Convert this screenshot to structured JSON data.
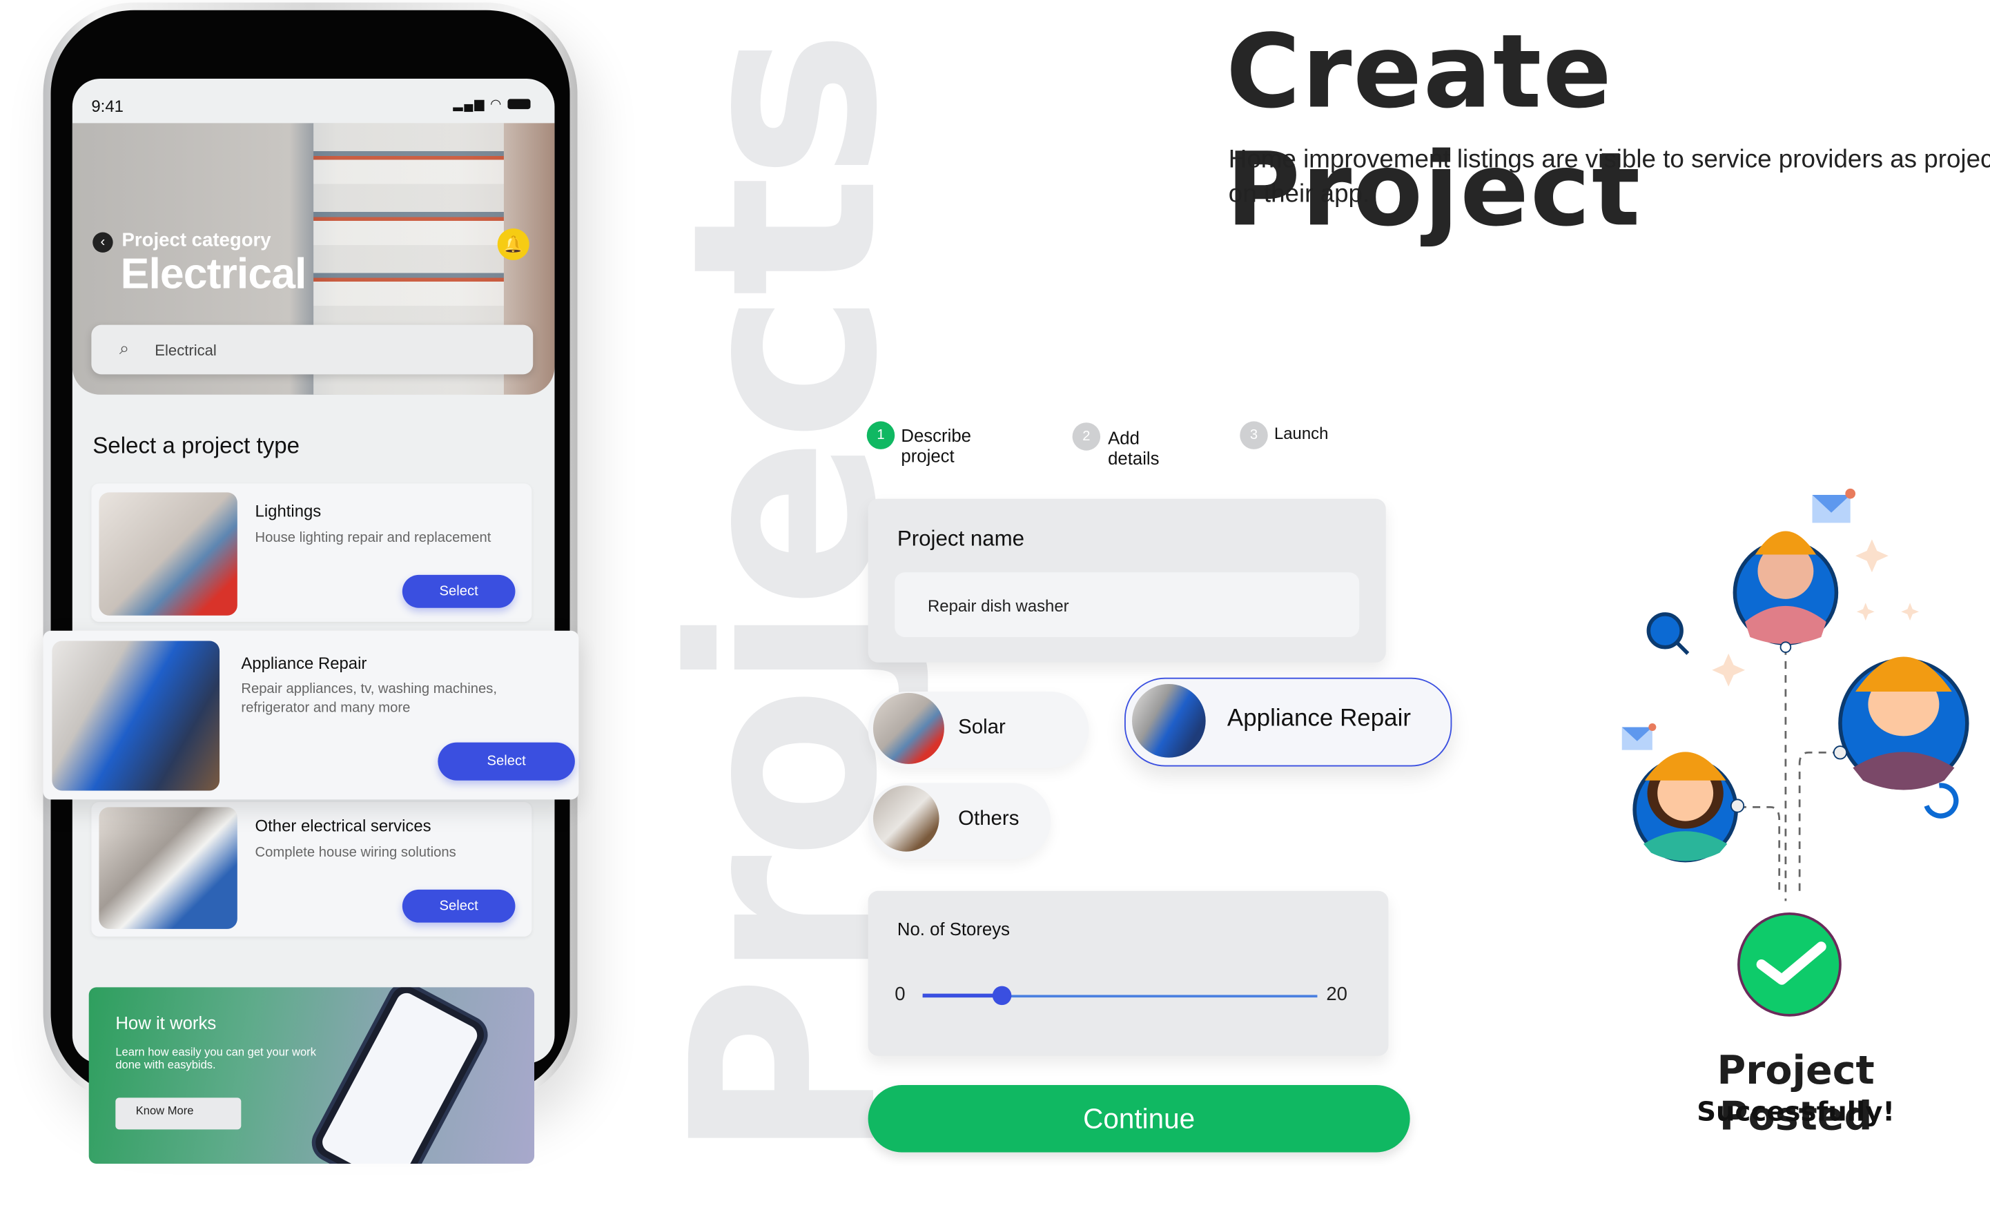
{
  "phone": {
    "status_time": "9:41",
    "hero": {
      "category_label": "Project category",
      "category_name": "Electrical"
    },
    "search": {
      "value": "Electrical"
    },
    "section_title": "Select a project type",
    "project_types": [
      {
        "title": "Lightings",
        "description": "House lighting repair and replacement",
        "button": "Select"
      },
      {
        "title": "Appliance Repair",
        "description": "Repair appliances, tv, washing machines, refrigerator and many more",
        "button": "Select"
      },
      {
        "title": "Other electrical services",
        "description": "Complete house wiring solutions",
        "button": "Select"
      }
    ],
    "how_it_works": {
      "title": "How it works",
      "text": "Learn how easily you can get your work done with easybids.",
      "button": "Know More"
    }
  },
  "watermark": "Projects",
  "header": {
    "title": "Create Project",
    "subtitle": "Home improvement listings are visible to service providers as projects on their app."
  },
  "steps": [
    {
      "number": "1",
      "label": "Describe project",
      "active": true
    },
    {
      "number": "2",
      "label": "Add details",
      "active": false
    },
    {
      "number": "3",
      "label": "Launch",
      "active": false
    }
  ],
  "form": {
    "project_name_label": "Project name",
    "project_name_value": "Repair dish washer",
    "categories": [
      {
        "label": "Solar",
        "selected": false
      },
      {
        "label": "Appliance Repair",
        "selected": true
      },
      {
        "label": "Others",
        "selected": false
      }
    ],
    "storeys": {
      "label": "No. of Storeys",
      "min": "0",
      "max": "20",
      "value": 4
    },
    "continue_label": "Continue"
  },
  "success": {
    "title": "Project Posted",
    "subtitle": "Successfully!"
  },
  "colors": {
    "primary_blue": "#3a4fe0",
    "green": "#10b862",
    "hardhat": "#f29b12",
    "avatar_bg": "#0c6ad3"
  }
}
